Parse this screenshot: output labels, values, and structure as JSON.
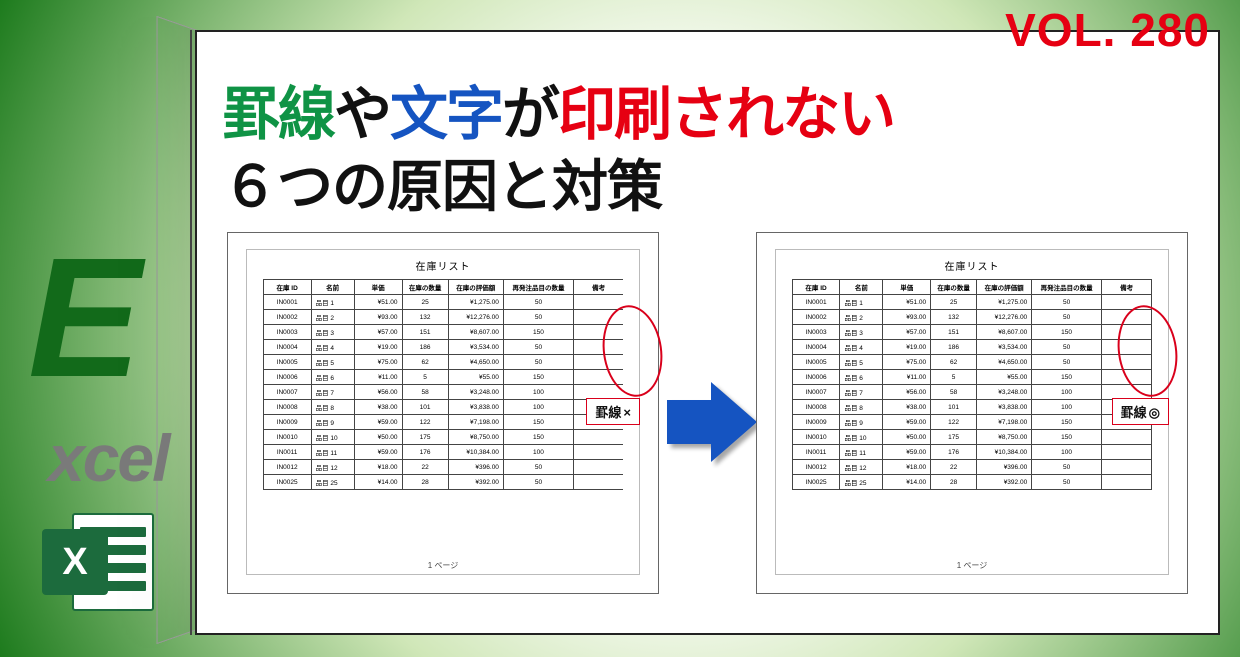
{
  "vol": "VOL. 280",
  "left_label": {
    "E": "E",
    "xcel": "xcel",
    "icon_letter": "X"
  },
  "headline": {
    "part1": "罫線",
    "mid1": "や",
    "part2": "文字",
    "mid2": "が",
    "part3": "印刷されない"
  },
  "subhead": "６つの原因と対策",
  "preview_title": "在庫リスト",
  "footer": "1 ページ",
  "columns": [
    "在庫 ID",
    "名前",
    "単価",
    "在庫の数量",
    "在庫の評価額",
    "再発注品目の数量",
    "備考"
  ],
  "rows": [
    [
      "IN0001",
      "品目 1",
      "¥51.00",
      "25",
      "¥1,275.00",
      "50",
      ""
    ],
    [
      "IN0002",
      "品目 2",
      "¥93.00",
      "132",
      "¥12,276.00",
      "50",
      ""
    ],
    [
      "IN0003",
      "品目 3",
      "¥57.00",
      "151",
      "¥8,607.00",
      "150",
      ""
    ],
    [
      "IN0004",
      "品目 4",
      "¥19.00",
      "186",
      "¥3,534.00",
      "50",
      ""
    ],
    [
      "IN0005",
      "品目 5",
      "¥75.00",
      "62",
      "¥4,650.00",
      "50",
      ""
    ],
    [
      "IN0006",
      "品目 6",
      "¥11.00",
      "5",
      "¥55.00",
      "150",
      ""
    ],
    [
      "IN0007",
      "品目 7",
      "¥56.00",
      "58",
      "¥3,248.00",
      "100",
      ""
    ],
    [
      "IN0008",
      "品目 8",
      "¥38.00",
      "101",
      "¥3,838.00",
      "100",
      ""
    ],
    [
      "IN0009",
      "品目 9",
      "¥59.00",
      "122",
      "¥7,198.00",
      "150",
      ""
    ],
    [
      "IN0010",
      "品目 10",
      "¥50.00",
      "175",
      "¥8,750.00",
      "150",
      ""
    ],
    [
      "IN0011",
      "品目 11",
      "¥59.00",
      "176",
      "¥10,384.00",
      "100",
      ""
    ],
    [
      "IN0012",
      "品目 12",
      "¥18.00",
      "22",
      "¥396.00",
      "50",
      ""
    ],
    [
      "IN0025",
      "品目 25",
      "¥14.00",
      "28",
      "¥392.00",
      "50",
      ""
    ]
  ],
  "tagL": {
    "label": "罫線",
    "mark": "×"
  },
  "tagR": {
    "label": "罫線",
    "mark": "◎"
  }
}
